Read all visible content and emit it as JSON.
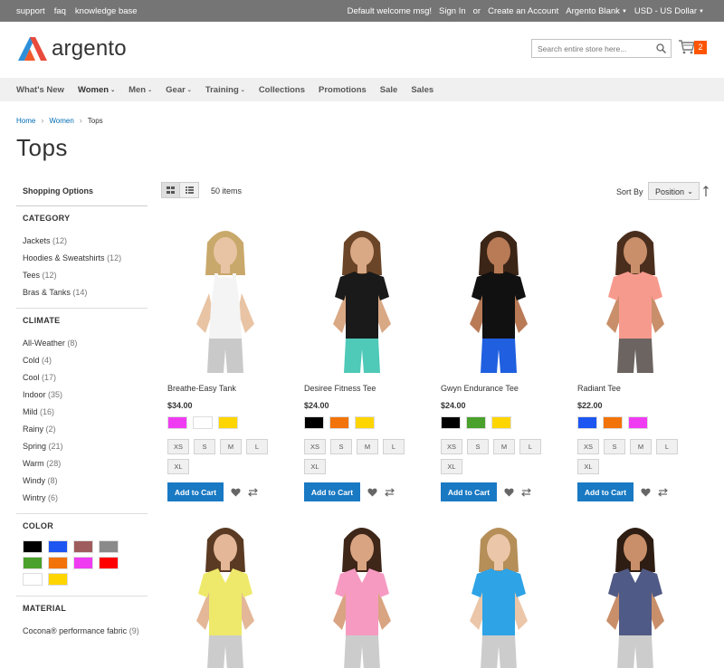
{
  "topbar": {
    "links": [
      "support",
      "faq",
      "knowledge base"
    ],
    "welcome": "Default welcome msg!",
    "signin": "Sign In",
    "or": "or",
    "create": "Create an Account",
    "store": "Argento Blank",
    "currency": "USD - US Dollar"
  },
  "header": {
    "logo_text": "argento",
    "search_placeholder": "Search entire store here...",
    "cart_count": "2"
  },
  "nav": [
    "What's New",
    "Women",
    "Men",
    "Gear",
    "Training",
    "Collections",
    "Promotions",
    "Sale",
    "Sales"
  ],
  "breadcrumb": [
    "Home",
    "Women",
    "Tops"
  ],
  "page_title": "Tops",
  "sidebar": {
    "title": "Shopping Options",
    "category": {
      "title": "CATEGORY",
      "items": [
        {
          "label": "Jackets",
          "count": "(12)"
        },
        {
          "label": "Hoodies & Sweatshirts",
          "count": "(12)"
        },
        {
          "label": "Tees",
          "count": "(12)"
        },
        {
          "label": "Bras & Tanks",
          "count": "(14)"
        }
      ]
    },
    "climate": {
      "title": "CLIMATE",
      "items": [
        {
          "label": "All-Weather",
          "count": "(8)"
        },
        {
          "label": "Cold",
          "count": "(4)"
        },
        {
          "label": "Cool",
          "count": "(17)"
        },
        {
          "label": "Indoor",
          "count": "(35)"
        },
        {
          "label": "Mild",
          "count": "(16)"
        },
        {
          "label": "Rainy",
          "count": "(2)"
        },
        {
          "label": "Spring",
          "count": "(21)"
        },
        {
          "label": "Warm",
          "count": "(28)"
        },
        {
          "label": "Windy",
          "count": "(8)"
        },
        {
          "label": "Wintry",
          "count": "(6)"
        }
      ]
    },
    "color": {
      "title": "COLOR",
      "swatches": [
        "#000000",
        "#1d56f0",
        "#9e5c5c",
        "#8a8a8a",
        "#4aa12c",
        "#f27309",
        "#ef3cf2",
        "#ff0000",
        "#ffffff",
        "#ffd500"
      ]
    },
    "material": {
      "title": "MATERIAL",
      "items": [
        {
          "label": "Cocona® performance fabric",
          "count": "(9)"
        }
      ]
    }
  },
  "toolbar": {
    "count": "50 items",
    "sort_label": "Sort By",
    "sort_value": "Position"
  },
  "products": [
    {
      "name": "Breathe-Easy Tank",
      "price": "$34.00",
      "colors": [
        "#ef3cf2",
        "#ffffff",
        "#ffd500"
      ],
      "sizes": [
        "XS",
        "S",
        "M",
        "L",
        "XL"
      ],
      "top_color": "#f4f4f4",
      "bottom_color": "#c9c9c9",
      "skin": "#e8c4a4",
      "hair": "#c9a86b",
      "style": "tank"
    },
    {
      "name": "Desiree Fitness Tee",
      "price": "$24.00",
      "colors": [
        "#000000",
        "#f27309",
        "#ffd500"
      ],
      "sizes": [
        "XS",
        "S",
        "M",
        "L",
        "XL"
      ],
      "top_color": "#1a1a1a",
      "bottom_color": "#4fc9b8",
      "skin": "#d9a884",
      "hair": "#6b4527",
      "style": "tee"
    },
    {
      "name": "Gwyn Endurance Tee",
      "price": "$24.00",
      "colors": [
        "#000000",
        "#4aa12c",
        "#ffd500"
      ],
      "sizes": [
        "XS",
        "S",
        "M",
        "L",
        "XL"
      ],
      "top_color": "#111111",
      "bottom_color": "#1f5fe0",
      "skin": "#b97a56",
      "hair": "#3b2516",
      "style": "tee"
    },
    {
      "name": "Radiant Tee",
      "price": "$22.00",
      "colors": [
        "#1d56f0",
        "#f27309",
        "#ef3cf2"
      ],
      "sizes": [
        "XS",
        "S",
        "M",
        "L",
        "XL"
      ],
      "top_color": "#f79a8e",
      "bottom_color": "#6b6460",
      "skin": "#c98f6a",
      "hair": "#4a2e1d",
      "style": "tee"
    },
    {
      "top_color": "#eee96a",
      "skin": "#e3b797",
      "hair": "#5a3a22",
      "style": "vtee"
    },
    {
      "top_color": "#f69ac2",
      "skin": "#d9a482",
      "hair": "#3e2618",
      "style": "vtee"
    },
    {
      "top_color": "#2ea3e6",
      "skin": "#ebc6a8",
      "hair": "#b58e58",
      "style": "tee"
    },
    {
      "top_color": "#505a86",
      "skin": "#c98f6a",
      "hair": "#2e1d12",
      "style": "vtee"
    }
  ],
  "add_to_cart": "Add to Cart"
}
